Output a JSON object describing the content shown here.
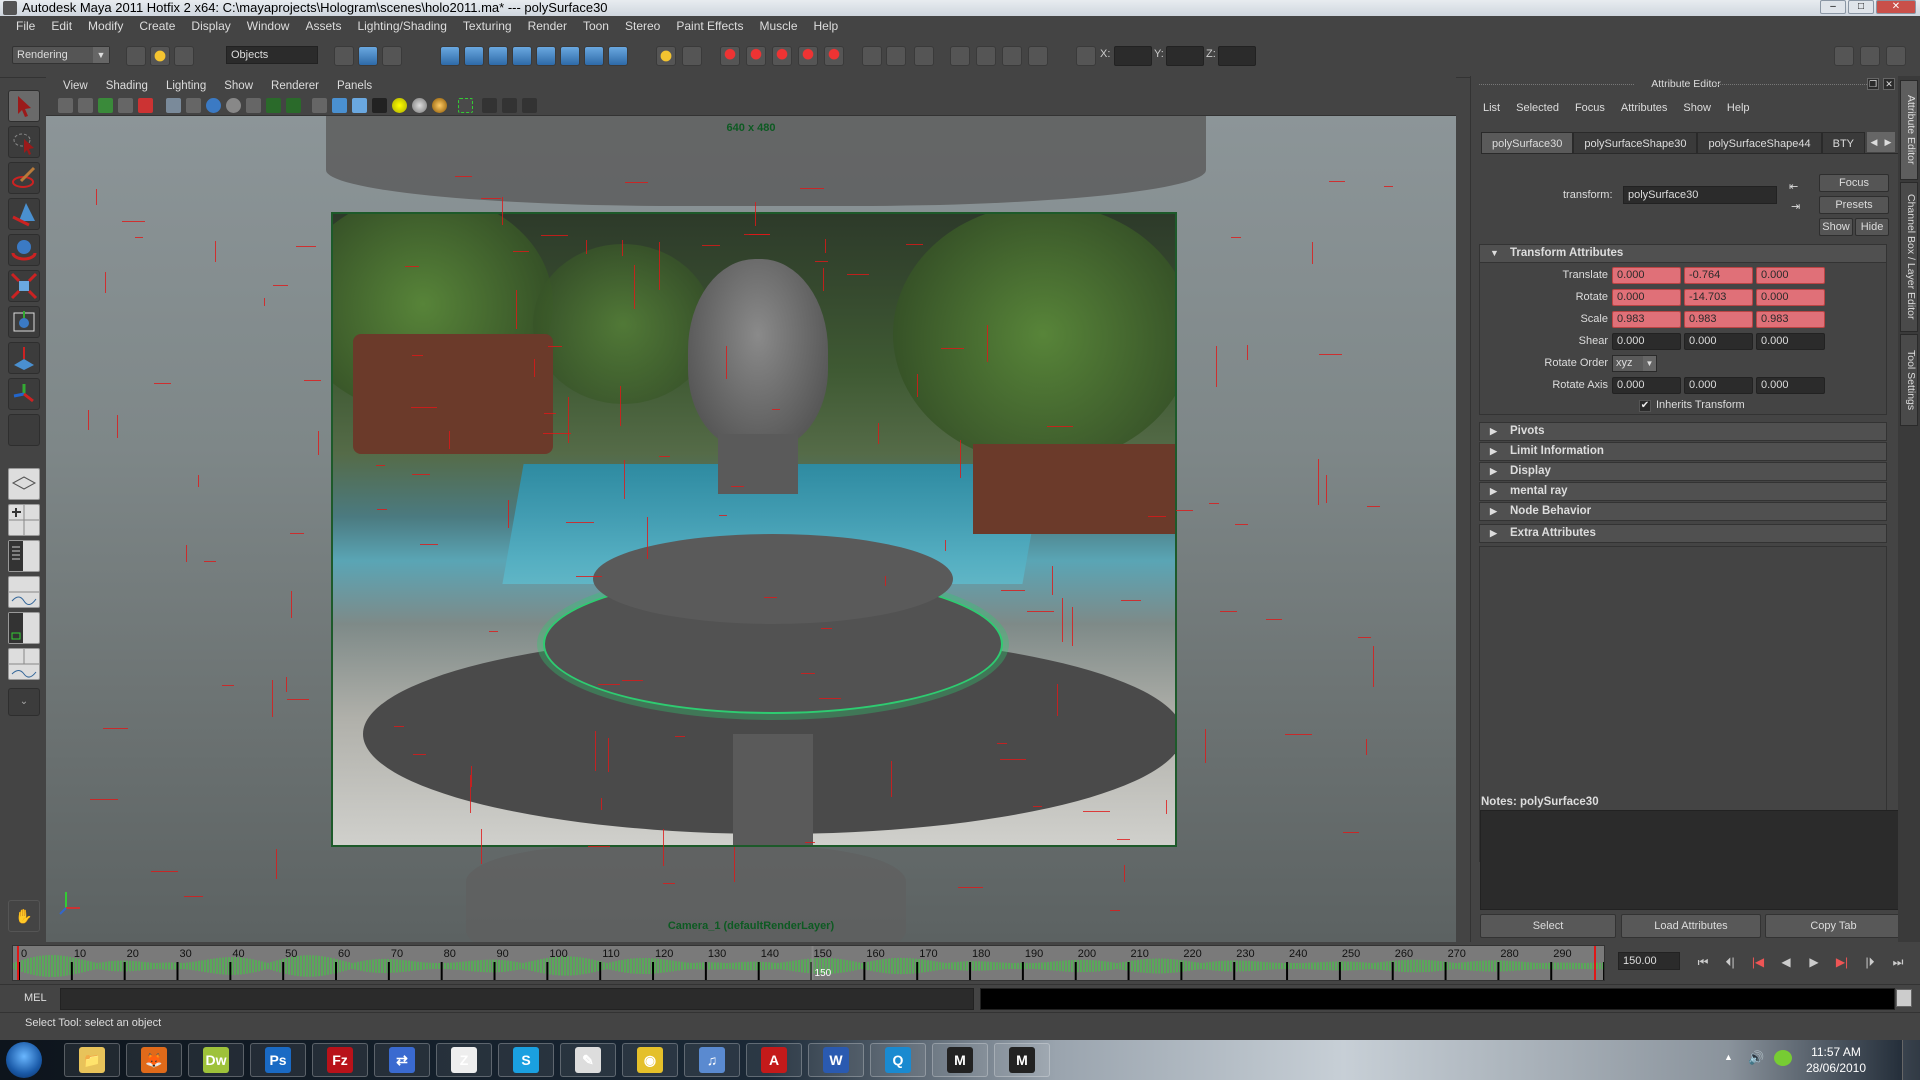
{
  "window": {
    "title": "Autodesk Maya 2011 Hotfix 2 x64: C:\\mayaprojects\\Hologram\\scenes\\holo2011.ma*  ---  polySurface30",
    "controls": [
      "minimize",
      "maximize",
      "close"
    ]
  },
  "menubar": [
    "File",
    "Edit",
    "Modify",
    "Create",
    "Display",
    "Window",
    "Assets",
    "Lighting/Shading",
    "Texturing",
    "Render",
    "Toon",
    "Stereo",
    "Paint Effects",
    "Muscle",
    "Help"
  ],
  "statusline": {
    "menu_set": "Rendering",
    "selection_mode": "Objects",
    "x_label": "X:",
    "y_label": "Y:",
    "z_label": "Z:",
    "x_value": "",
    "y_value": "",
    "z_value": ""
  },
  "toolbox": {
    "tools": [
      "select-tool",
      "lasso-tool",
      "paint-select-tool",
      "move-tool",
      "rotate-tool",
      "scale-tool",
      "universal-manipulator",
      "soft-modification-tool",
      "show-manipulator",
      "last-tool-slot"
    ],
    "layouts": [
      "single-perspective-view",
      "four-view",
      "outliner-perspective",
      "perspective-graph-editor",
      "hypershade-perspective",
      "perspective-graph-hypergraph",
      "layout-expand"
    ]
  },
  "panel": {
    "menus": [
      "View",
      "Shading",
      "Lighting",
      "Show",
      "Renderer",
      "Panels"
    ],
    "resolution_label": "640 x 480",
    "camera_label": "Camera_1 (defaultRenderLayer)"
  },
  "attribute_editor": {
    "title": "Attribute Editor",
    "menus": [
      "List",
      "Selected",
      "Focus",
      "Attributes",
      "Show",
      "Help"
    ],
    "tabs": [
      {
        "label": "polySurface30",
        "active": true
      },
      {
        "label": "polySurfaceShape30",
        "active": false
      },
      {
        "label": "polySurfaceShape44",
        "active": false
      },
      {
        "label": "BTY",
        "active": false
      }
    ],
    "transform_label": "transform:",
    "transform_value": "polySurface30",
    "buttons": {
      "focus": "Focus",
      "presets": "Presets",
      "show": "Show",
      "hide": "Hide"
    },
    "transform_section": "Transform Attributes",
    "attributes": {
      "translate": {
        "label": "Translate",
        "values": [
          "0.000",
          "-0.764",
          "0.000"
        ],
        "keyed": true
      },
      "rotate": {
        "label": "Rotate",
        "values": [
          "0.000",
          "-14.703",
          "0.000"
        ],
        "keyed": true
      },
      "scale": {
        "label": "Scale",
        "values": [
          "0.983",
          "0.983",
          "0.983"
        ],
        "keyed": true
      },
      "shear": {
        "label": "Shear",
        "values": [
          "0.000",
          "0.000",
          "0.000"
        ],
        "keyed": false
      },
      "rotate_order": {
        "label": "Rotate Order",
        "value": "xyz"
      },
      "rotate_axis": {
        "label": "Rotate Axis",
        "values": [
          "0.000",
          "0.000",
          "0.000"
        ],
        "keyed": false
      },
      "inherits_transform": {
        "label": "Inherits Transform",
        "checked": true
      }
    },
    "collapsed_sections": [
      "Pivots",
      "Limit Information",
      "Display",
      "mental ray",
      "Node Behavior",
      "Extra Attributes"
    ],
    "notes_label": "Notes:  polySurface30",
    "notes_value": "",
    "bottom_buttons": {
      "select": "Select",
      "load": "Load Attributes",
      "copy": "Copy Tab"
    },
    "key_color": "#e07078"
  },
  "side_tabs": [
    "Attribute Editor",
    "Channel Box / Layer Editor",
    "Tool Settings"
  ],
  "timeline": {
    "ticks": [
      "0",
      "10",
      "20",
      "30",
      "40",
      "50",
      "60",
      "70",
      "80",
      "90",
      "100",
      "110",
      "120",
      "130",
      "140",
      "150",
      "160",
      "170",
      "180",
      "190",
      "200",
      "210",
      "220",
      "230",
      "240",
      "250",
      "260",
      "270",
      "280",
      "290",
      "30"
    ],
    "current_frame_marker": "150",
    "current_time": "150.00",
    "playback_buttons": [
      "go-to-start",
      "step-back-key",
      "step-back-frame",
      "play-backwards",
      "play-forwards",
      "step-forward-frame",
      "step-forward-key",
      "go-to-end"
    ]
  },
  "command_line": {
    "label": "MEL",
    "input": "",
    "output": ""
  },
  "help_line": "Select Tool: select an object",
  "taskbar": {
    "apps": [
      {
        "name": "windows-explorer",
        "glyph": "📁"
      },
      {
        "name": "firefox",
        "glyph": "🦊"
      },
      {
        "name": "dreamweaver",
        "glyph": "Dw"
      },
      {
        "name": "photoshop",
        "glyph": "Ps"
      },
      {
        "name": "filezilla",
        "glyph": "Fz"
      },
      {
        "name": "network-connection",
        "glyph": "⇄"
      },
      {
        "name": "zbrush",
        "glyph": "Z"
      },
      {
        "name": "skype",
        "glyph": "S"
      },
      {
        "name": "notepad",
        "glyph": "✎"
      },
      {
        "name": "chrome",
        "glyph": "◉"
      },
      {
        "name": "itunes",
        "glyph": "♫"
      },
      {
        "name": "acrobat",
        "glyph": "A"
      },
      {
        "name": "word",
        "glyph": "W"
      },
      {
        "name": "quicktime",
        "glyph": "Q"
      },
      {
        "name": "maya",
        "glyph": "M"
      },
      {
        "name": "maya-2",
        "glyph": "M"
      }
    ],
    "time": "11:57 AM",
    "date": "28/06/2010"
  }
}
